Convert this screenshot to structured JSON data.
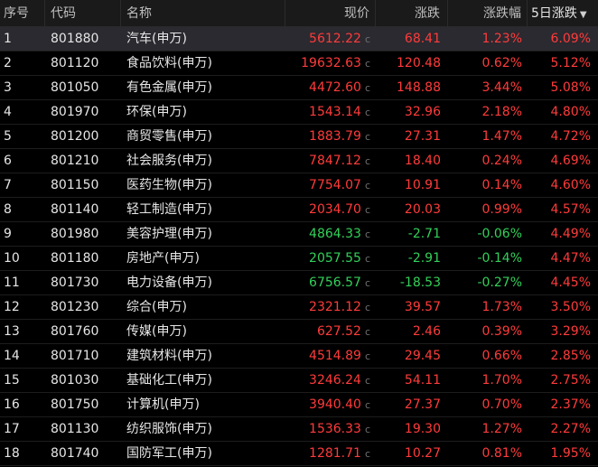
{
  "header": {
    "index": "序号",
    "code": "代码",
    "name": "名称",
    "price": "现价",
    "change": "涨跌",
    "pct": "涨跌幅",
    "five_day": "5日涨跌",
    "sort_icon": "triangle-down"
  },
  "colors": {
    "up": "#ff3b3b",
    "down": "#33d05a",
    "text": "#e6e6e6"
  },
  "rows": [
    {
      "idx": "1",
      "code": "801880",
      "name": "汽车(申万)",
      "price": "5612.22",
      "mark": "c",
      "change": "68.41",
      "pct": "1.23%",
      "five": "6.09%",
      "dir": "up"
    },
    {
      "idx": "2",
      "code": "801120",
      "name": "食品饮料(申万)",
      "price": "19632.63",
      "mark": "c",
      "change": "120.48",
      "pct": "0.62%",
      "five": "5.12%",
      "dir": "up"
    },
    {
      "idx": "3",
      "code": "801050",
      "name": "有色金属(申万)",
      "price": "4472.60",
      "mark": "c",
      "change": "148.88",
      "pct": "3.44%",
      "five": "5.08%",
      "dir": "up"
    },
    {
      "idx": "4",
      "code": "801970",
      "name": "环保(申万)",
      "price": "1543.14",
      "mark": "c",
      "change": "32.96",
      "pct": "2.18%",
      "five": "4.80%",
      "dir": "up"
    },
    {
      "idx": "5",
      "code": "801200",
      "name": "商贸零售(申万)",
      "price": "1883.79",
      "mark": "c",
      "change": "27.31",
      "pct": "1.47%",
      "five": "4.72%",
      "dir": "up"
    },
    {
      "idx": "6",
      "code": "801210",
      "name": "社会服务(申万)",
      "price": "7847.12",
      "mark": "c",
      "change": "18.40",
      "pct": "0.24%",
      "five": "4.69%",
      "dir": "up"
    },
    {
      "idx": "7",
      "code": "801150",
      "name": "医药生物(申万)",
      "price": "7754.07",
      "mark": "c",
      "change": "10.91",
      "pct": "0.14%",
      "five": "4.60%",
      "dir": "up"
    },
    {
      "idx": "8",
      "code": "801140",
      "name": "轻工制造(申万)",
      "price": "2034.70",
      "mark": "c",
      "change": "20.03",
      "pct": "0.99%",
      "five": "4.57%",
      "dir": "up"
    },
    {
      "idx": "9",
      "code": "801980",
      "name": "美容护理(申万)",
      "price": "4864.33",
      "mark": "c",
      "change": "-2.71",
      "pct": "-0.06%",
      "five": "4.49%",
      "dir": "down"
    },
    {
      "idx": "10",
      "code": "801180",
      "name": "房地产(申万)",
      "price": "2057.55",
      "mark": "c",
      "change": "-2.91",
      "pct": "-0.14%",
      "five": "4.47%",
      "dir": "down"
    },
    {
      "idx": "11",
      "code": "801730",
      "name": "电力设备(申万)",
      "price": "6756.57",
      "mark": "c",
      "change": "-18.53",
      "pct": "-0.27%",
      "five": "4.45%",
      "dir": "down"
    },
    {
      "idx": "12",
      "code": "801230",
      "name": "综合(申万)",
      "price": "2321.12",
      "mark": "c",
      "change": "39.57",
      "pct": "1.73%",
      "five": "3.50%",
      "dir": "up"
    },
    {
      "idx": "13",
      "code": "801760",
      "name": "传媒(申万)",
      "price": "627.52",
      "mark": "c",
      "change": "2.46",
      "pct": "0.39%",
      "five": "3.29%",
      "dir": "up"
    },
    {
      "idx": "14",
      "code": "801710",
      "name": "建筑材料(申万)",
      "price": "4514.89",
      "mark": "c",
      "change": "29.45",
      "pct": "0.66%",
      "five": "2.85%",
      "dir": "up"
    },
    {
      "idx": "15",
      "code": "801030",
      "name": "基础化工(申万)",
      "price": "3246.24",
      "mark": "c",
      "change": "54.11",
      "pct": "1.70%",
      "five": "2.75%",
      "dir": "up"
    },
    {
      "idx": "16",
      "code": "801750",
      "name": "计算机(申万)",
      "price": "3940.40",
      "mark": "c",
      "change": "27.37",
      "pct": "0.70%",
      "five": "2.37%",
      "dir": "up"
    },
    {
      "idx": "17",
      "code": "801130",
      "name": "纺织服饰(申万)",
      "price": "1536.33",
      "mark": "c",
      "change": "19.30",
      "pct": "1.27%",
      "five": "2.27%",
      "dir": "up"
    },
    {
      "idx": "18",
      "code": "801740",
      "name": "国防军工(申万)",
      "price": "1281.71",
      "mark": "c",
      "change": "10.27",
      "pct": "0.81%",
      "five": "1.95%",
      "dir": "up"
    }
  ]
}
